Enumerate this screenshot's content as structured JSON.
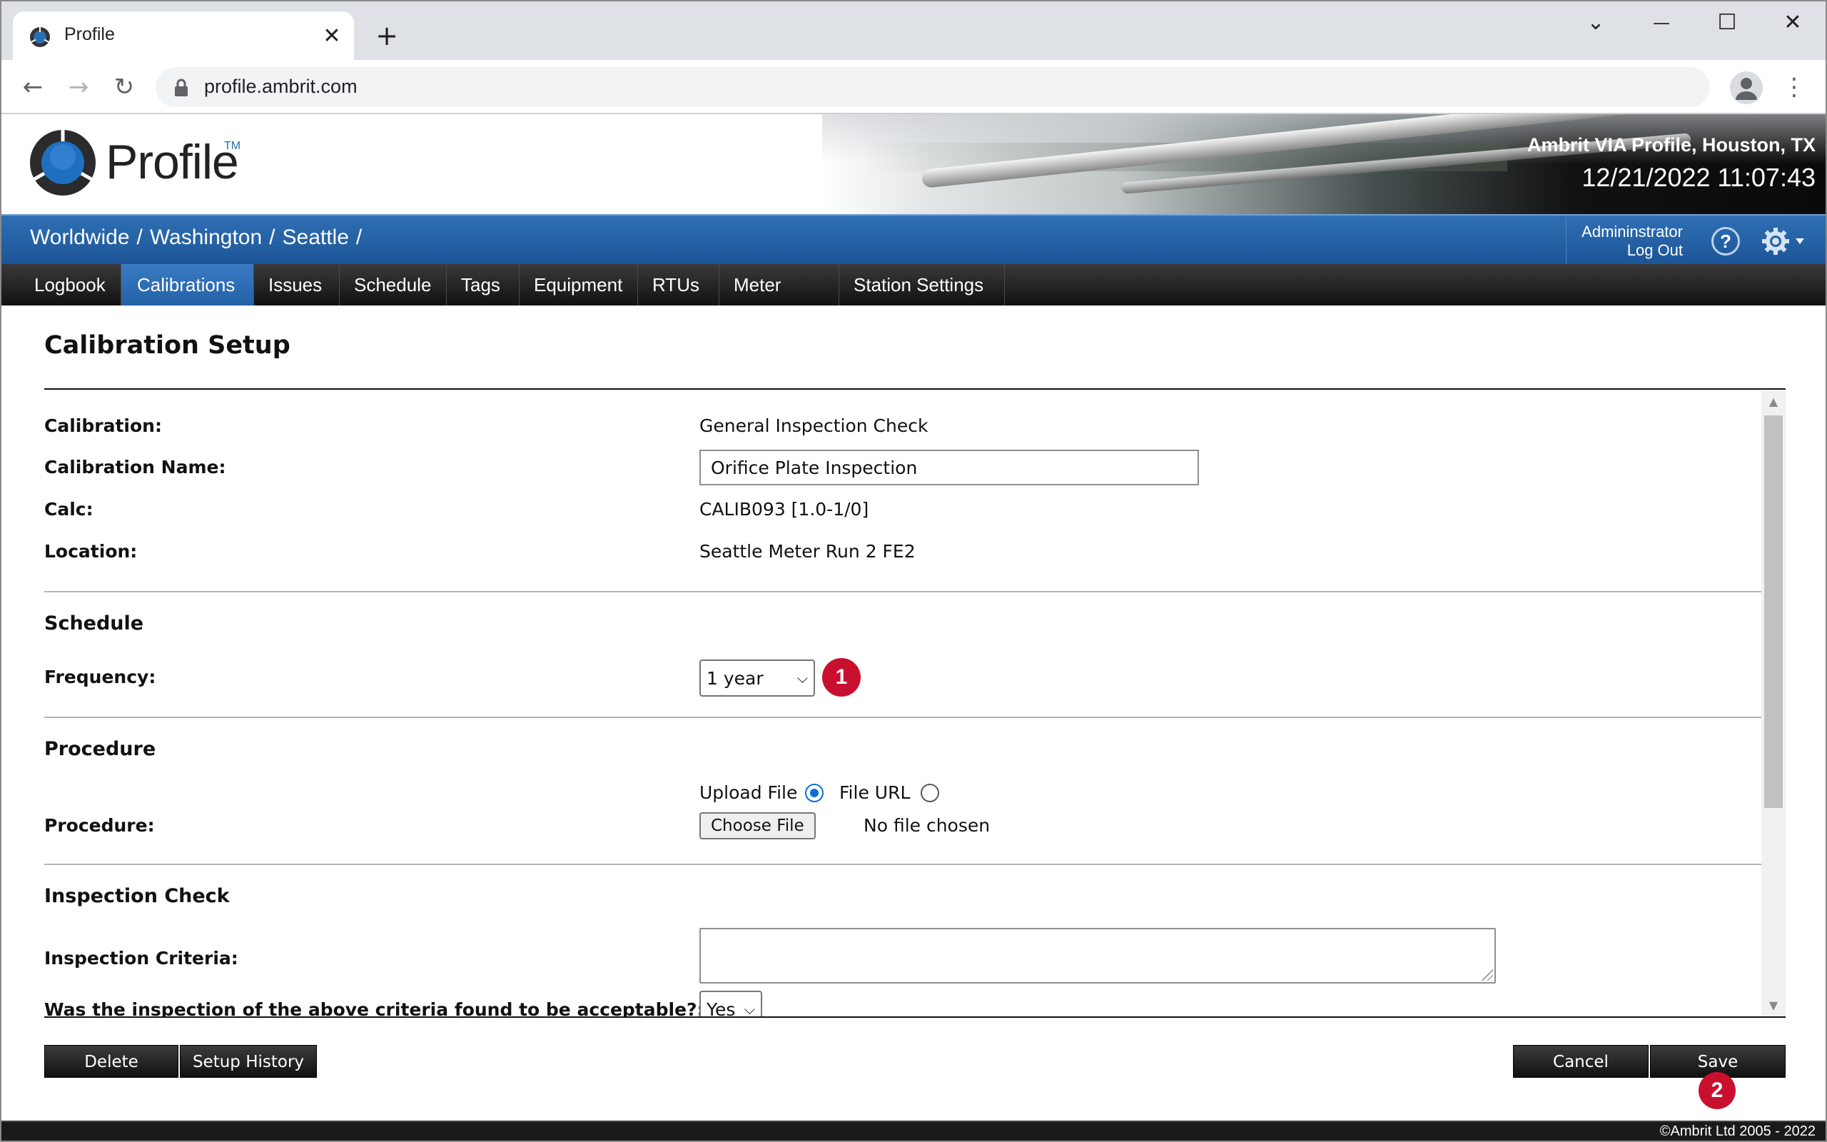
{
  "browser": {
    "tab_title": "Profile",
    "tab_close": "✕",
    "new_tab": "+",
    "url": "profile.ambrit.com",
    "window_controls": {
      "dropdown": "⌄",
      "minimize": "—",
      "maximize": "☐",
      "close": "✕"
    },
    "nav": {
      "back": "←",
      "forward": "→",
      "reload": "↻",
      "menu": "⋮"
    }
  },
  "header": {
    "logo_text": "Profile",
    "logo_tm": "TM",
    "site_title": "Ambrit VIA Profile, Houston, TX",
    "datetime": "12/21/2022 11:07:43"
  },
  "breadcrumb": {
    "items": [
      "Worldwide",
      "Washington",
      "Seattle"
    ],
    "separator": "/"
  },
  "user": {
    "name": "Admininstrator",
    "logout": "Log Out",
    "help": "?"
  },
  "nav": {
    "items": [
      {
        "label": "Logbook"
      },
      {
        "label": "Calibrations",
        "active": true
      },
      {
        "label": "Issues"
      },
      {
        "label": "Schedule"
      },
      {
        "label": "Tags"
      },
      {
        "label": "Equipment"
      },
      {
        "label": "RTUs"
      },
      {
        "label": "Meter Runs"
      },
      {
        "label": "Station Settings"
      }
    ]
  },
  "page": {
    "title": "Calibration Setup"
  },
  "form": {
    "calibration_label": "Calibration:",
    "calibration_value": "General Inspection Check",
    "name_label": "Calibration Name:",
    "name_value": "Orifice Plate Inspection",
    "calc_label": "Calc:",
    "calc_value": "CALIB093 [1.0-1/0]",
    "location_label": "Location:",
    "location_value": "Seattle Meter Run 2 FE2",
    "schedule_heading": "Schedule",
    "frequency_label": "Frequency:",
    "frequency_value": "1 year",
    "procedure_heading": "Procedure",
    "procedure_label": "Procedure:",
    "upload_file_label": "Upload File",
    "file_url_label": "File URL",
    "upload_selected": true,
    "choose_file_button": "Choose File",
    "file_status": "No file chosen",
    "inspection_heading": "Inspection Check",
    "criteria_label": "Inspection Criteria:",
    "criteria_value": "",
    "acceptable_label": "Was the inspection of the above criteria found to be acceptable?:",
    "acceptable_value": "Yes"
  },
  "annotations": {
    "badge_1": "1",
    "badge_2": "2"
  },
  "actions": {
    "delete": "Delete",
    "setup_history": "Setup History",
    "cancel": "Cancel",
    "save": "Save"
  },
  "footer": {
    "copyright": "©Ambrit Ltd 2005 - 2022"
  },
  "colors": {
    "accent_blue": "#2361a5",
    "badge_red": "#c8102e",
    "nav_dark": "#111111"
  }
}
